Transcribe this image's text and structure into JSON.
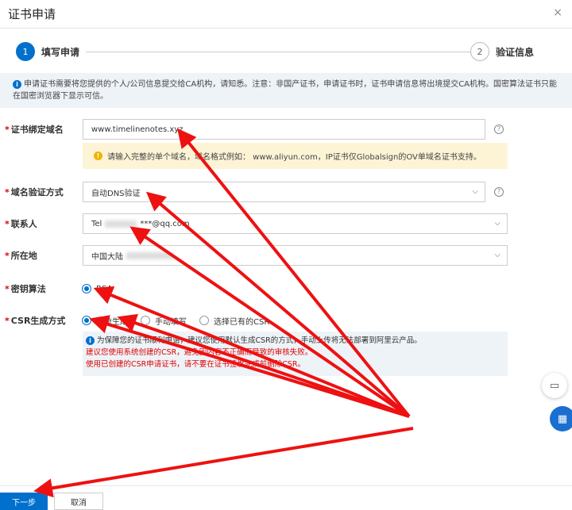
{
  "dialog": {
    "title": "证书申请",
    "close_icon": "×"
  },
  "steps": [
    {
      "num": "1",
      "label": "填写申请"
    },
    {
      "num": "2",
      "label": "验证信息"
    }
  ],
  "notice": "申请证书需要将您提供的个人/公司信息提交给CA机构，请知悉。注意：非国产证书，申请证书时，证书申请信息将出境提交CA机构。国密算法证书只能在国密浏览器下显示可信。",
  "form": {
    "domain": {
      "label": "证书绑定域名",
      "value": "www.timelinenotes.xyz",
      "tip": "请输入完整的单个域名，域名格式例如： www.aliyun.com，IP证书仅Globalsign的OV单域名证书支持。"
    },
    "verify": {
      "label": "域名验证方式",
      "value": "自动DNS验证"
    },
    "contact": {
      "label": "联系人",
      "value_prefix": "Tel",
      "value_suffix": "***@qq.com"
    },
    "location": {
      "label": "所在地",
      "value": "中国大陆"
    },
    "algorithm": {
      "label": "密钥算法",
      "option": "RSA"
    },
    "csr": {
      "label": "CSR生成方式",
      "options": [
        "系统生成",
        "手动填写",
        "选择已有的CSR"
      ],
      "note": "为保障您的证书顺利申请，建议您使用默认生成CSR的方式，手动上传将无法部署到阿里云产品。",
      "red1": "建议您使用系统创建的CSR，避免因内容不正确而导致的审核失败。",
      "red2": "使用已创建的CSR申请证书，请不要在证书签发完成前删除CSR。"
    }
  },
  "footer": {
    "next": "下一步",
    "cancel": "取消"
  },
  "colors": {
    "primary": "#0070cc",
    "annotation": "#ee1111"
  }
}
